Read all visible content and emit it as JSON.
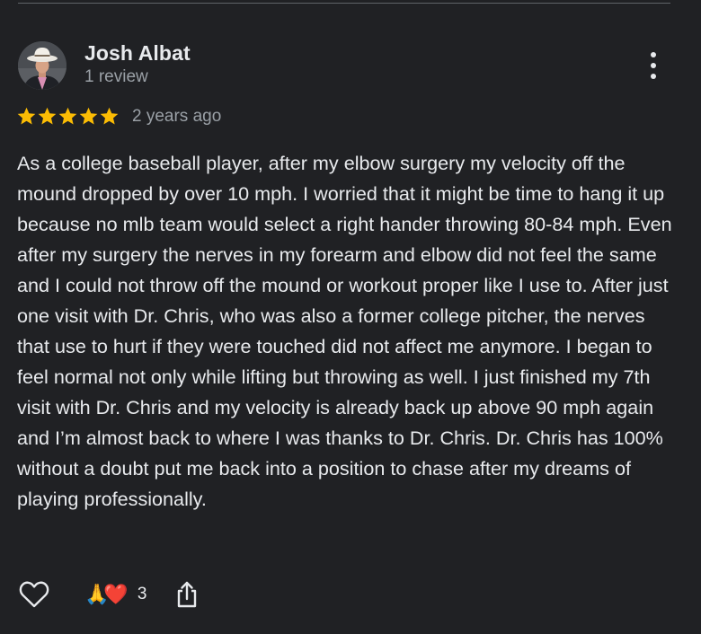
{
  "review": {
    "author": {
      "name": "Josh Albat",
      "review_count": "1 review",
      "avatar_icon": "profile-photo-cowboy-hat"
    },
    "rating": 5,
    "rating_max": 5,
    "star_color": "#fbbc04",
    "date": "2 years ago",
    "text": "As a college baseball player, after my elbow surgery my velocity off the mound dropped by over 10 mph. I worried that it might be time to hang it up because no mlb team would select a right hander throwing 80-84 mph. Even after my surgery the nerves in my forearm and elbow did not feel the same and I could not throw off the mound or workout proper like I use to. After just one visit with Dr. Chris, who was also a former college pitcher, the nerves that use to hurt if they were touched did not affect me anymore. I began to feel normal not only while lifting but throwing as well. I just finished my 7th visit with Dr. Chris and my velocity is already back up above 90 mph again and I’m almost back to where I was thanks to Dr. Chris. Dr. Chris has 100% without a doubt put me back into a position to chase after my dreams of playing professionally.",
    "reactions": {
      "emojis": [
        "🙏",
        "❤️"
      ],
      "count": "3"
    },
    "icons": {
      "more": "more-vert-icon",
      "like": "heart-outline-icon",
      "share": "share-icon"
    }
  }
}
